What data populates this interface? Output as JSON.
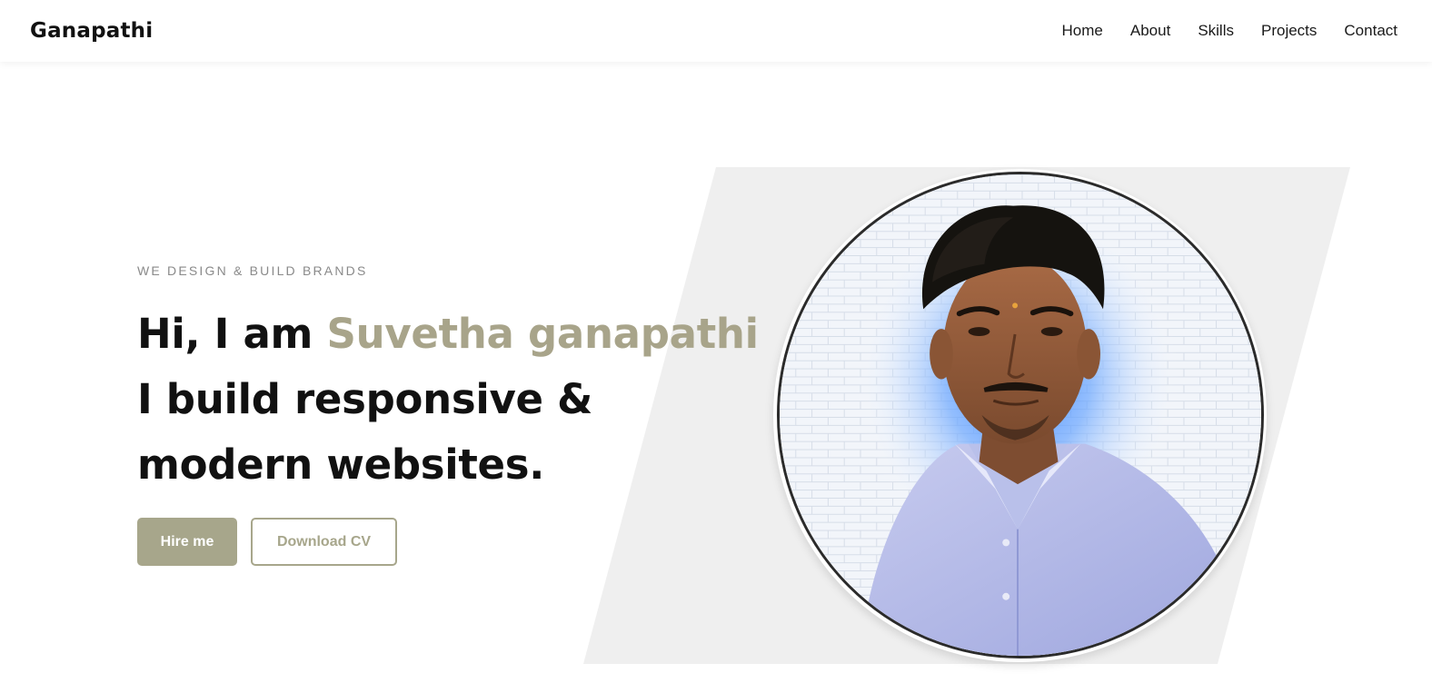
{
  "header": {
    "brand": "Ganapathi",
    "nav": [
      {
        "label": "Home"
      },
      {
        "label": "About"
      },
      {
        "label": "Skills"
      },
      {
        "label": "Projects"
      },
      {
        "label": "Contact"
      }
    ]
  },
  "hero": {
    "tagline": "WE DESIGN & BUILD BRANDS",
    "greeting": "Hi, I am ",
    "name": "Suvetha ganapathi",
    "line2": "I build responsive &",
    "line3": "modern websites.",
    "primary_button": "Hire me",
    "secondary_button": "Download CV",
    "portrait_icon": "person-portrait-icon"
  },
  "colors": {
    "accent": "#a7a68b",
    "text": "#111111",
    "panel": "#efefef",
    "glow": "#3d8dff"
  }
}
